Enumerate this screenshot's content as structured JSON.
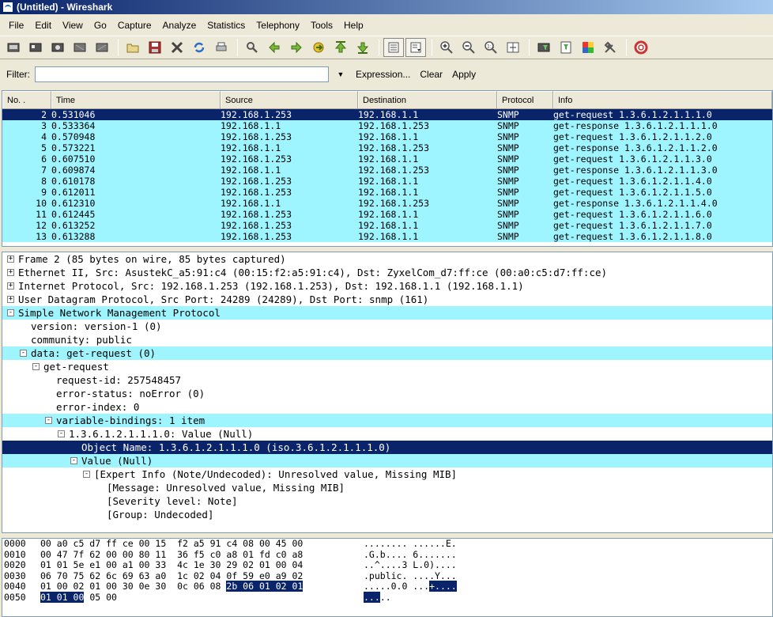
{
  "window": {
    "title": "(Untitled) - Wireshark"
  },
  "menu": [
    "File",
    "Edit",
    "View",
    "Go",
    "Capture",
    "Analyze",
    "Statistics",
    "Telephony",
    "Tools",
    "Help"
  ],
  "filter": {
    "label": "Filter:",
    "value": "",
    "expression": "Expression...",
    "clear": "Clear",
    "apply": "Apply"
  },
  "columns": [
    "No. .",
    "Time",
    "Source",
    "Destination",
    "Protocol",
    "Info"
  ],
  "packets": [
    {
      "no": "2",
      "time": "0.531046",
      "src": "192.168.1.253",
      "dst": "192.168.1.1",
      "proto": "SNMP",
      "info": "get-request 1.3.6.1.2.1.1.1.0"
    },
    {
      "no": "3",
      "time": "0.533364",
      "src": "192.168.1.1",
      "dst": "192.168.1.253",
      "proto": "SNMP",
      "info": "get-response 1.3.6.1.2.1.1.1.0"
    },
    {
      "no": "4",
      "time": "0.570948",
      "src": "192.168.1.253",
      "dst": "192.168.1.1",
      "proto": "SNMP",
      "info": "get-request 1.3.6.1.2.1.1.2.0"
    },
    {
      "no": "5",
      "time": "0.573221",
      "src": "192.168.1.1",
      "dst": "192.168.1.253",
      "proto": "SNMP",
      "info": "get-response 1.3.6.1.2.1.1.2.0"
    },
    {
      "no": "6",
      "time": "0.607510",
      "src": "192.168.1.253",
      "dst": "192.168.1.1",
      "proto": "SNMP",
      "info": "get-request 1.3.6.1.2.1.1.3.0"
    },
    {
      "no": "7",
      "time": "0.609874",
      "src": "192.168.1.1",
      "dst": "192.168.1.253",
      "proto": "SNMP",
      "info": "get-response 1.3.6.1.2.1.1.3.0"
    },
    {
      "no": "8",
      "time": "0.610178",
      "src": "192.168.1.253",
      "dst": "192.168.1.1",
      "proto": "SNMP",
      "info": "get-request 1.3.6.1.2.1.1.4.0"
    },
    {
      "no": "9",
      "time": "0.612011",
      "src": "192.168.1.253",
      "dst": "192.168.1.1",
      "proto": "SNMP",
      "info": "get-request 1.3.6.1.2.1.1.5.0"
    },
    {
      "no": "10",
      "time": "0.612310",
      "src": "192.168.1.1",
      "dst": "192.168.1.253",
      "proto": "SNMP",
      "info": "get-response 1.3.6.1.2.1.1.4.0"
    },
    {
      "no": "11",
      "time": "0.612445",
      "src": "192.168.1.253",
      "dst": "192.168.1.1",
      "proto": "SNMP",
      "info": "get-request 1.3.6.1.2.1.1.6.0"
    },
    {
      "no": "12",
      "time": "0.613252",
      "src": "192.168.1.253",
      "dst": "192.168.1.1",
      "proto": "SNMP",
      "info": "get-request 1.3.6.1.2.1.1.7.0"
    },
    {
      "no": "13",
      "time": "0.613288",
      "src": "192.168.1.253",
      "dst": "192.168.1.1",
      "proto": "SNMP",
      "info": "get-request 1.3.6.1.2.1.1.8.0"
    }
  ],
  "details": [
    {
      "text": "Frame 2 (85 bytes on wire, 85 bytes captured)",
      "toggle": "+",
      "level": 0,
      "style": ""
    },
    {
      "text": "Ethernet II, Src: AsustekC_a5:91:c4 (00:15:f2:a5:91:c4), Dst: ZyxelCom_d7:ff:ce (00:a0:c5:d7:ff:ce)",
      "toggle": "+",
      "level": 0,
      "style": ""
    },
    {
      "text": "Internet Protocol, Src: 192.168.1.253 (192.168.1.253), Dst: 192.168.1.1 (192.168.1.1)",
      "toggle": "+",
      "level": 0,
      "style": ""
    },
    {
      "text": "User Datagram Protocol, Src Port: 24289 (24289), Dst Port: snmp (161)",
      "toggle": "+",
      "level": 0,
      "style": ""
    },
    {
      "text": "Simple Network Management Protocol",
      "toggle": "-",
      "level": 0,
      "style": "hl"
    },
    {
      "text": "version: version-1 (0)",
      "toggle": "",
      "level": 1,
      "style": ""
    },
    {
      "text": "community: public",
      "toggle": "",
      "level": 1,
      "style": ""
    },
    {
      "text": "data: get-request (0)",
      "toggle": "-",
      "level": 1,
      "style": "hl"
    },
    {
      "text": "get-request",
      "toggle": "-",
      "level": 2,
      "style": ""
    },
    {
      "text": "request-id: 257548457",
      "toggle": "",
      "level": 3,
      "style": ""
    },
    {
      "text": "error-status: noError (0)",
      "toggle": "",
      "level": 3,
      "style": ""
    },
    {
      "text": "error-index: 0",
      "toggle": "",
      "level": 3,
      "style": ""
    },
    {
      "text": "variable-bindings: 1 item",
      "toggle": "-",
      "level": 3,
      "style": "hl"
    },
    {
      "text": "1.3.6.1.2.1.1.1.0: Value (Null)",
      "toggle": "-",
      "level": 4,
      "style": ""
    },
    {
      "text": "Object Name: 1.3.6.1.2.1.1.1.0 (iso.3.6.1.2.1.1.1.0)",
      "toggle": "",
      "level": 5,
      "style": "sel"
    },
    {
      "text": "Value (Null)",
      "toggle": "-",
      "level": 5,
      "style": "hl"
    },
    {
      "text": "[Expert Info (Note/Undecoded): Unresolved value, Missing MIB]",
      "toggle": "-",
      "level": 6,
      "style": ""
    },
    {
      "text": "[Message: Unresolved value, Missing MIB]",
      "toggle": "",
      "level": 7,
      "style": ""
    },
    {
      "text": "[Severity level: Note]",
      "toggle": "",
      "level": 7,
      "style": ""
    },
    {
      "text": "[Group: Undecoded]",
      "toggle": "",
      "level": 7,
      "style": ""
    }
  ],
  "hex": [
    {
      "off": "0000",
      "bytes": "00 a0 c5 d7 ff ce 00 15  f2 a5 91 c4 08 00 45 00",
      "mark": "",
      "after": "",
      "ascii": "........ ......E.",
      "amark": "",
      "aafter": ""
    },
    {
      "off": "0010",
      "bytes": "00 47 7f 62 00 00 80 11  36 f5 c0 a8 01 fd c0 a8",
      "mark": "",
      "after": "",
      "ascii": ".G.b.... 6.......",
      "amark": "",
      "aafter": ""
    },
    {
      "off": "0020",
      "bytes": "01 01 5e e1 00 a1 00 33  4c 1e 30 29 02 01 00 04",
      "mark": "",
      "after": "",
      "ascii": "..^....3 L.0)....",
      "amark": "",
      "aafter": ""
    },
    {
      "off": "0030",
      "bytes": "06 70 75 62 6c 69 63 a0  1c 02 04 0f 59 e0 a9 02",
      "mark": "",
      "after": "",
      "ascii": ".public. ....Y...",
      "amark": "",
      "aafter": ""
    },
    {
      "off": "0040",
      "bytes": "01 00 02 01 00 30 0e 30  0c 06 08 ",
      "mark": "2b 06 01 02 01",
      "after": "",
      "ascii": ".....0.0 ...",
      "amark": "+....",
      "aafter": ""
    },
    {
      "off": "0050",
      "bytes": "",
      "mark": "01 01 00",
      "after": " 05 00",
      "ascii": "",
      "amark": "...",
      "aafter": ".."
    }
  ]
}
